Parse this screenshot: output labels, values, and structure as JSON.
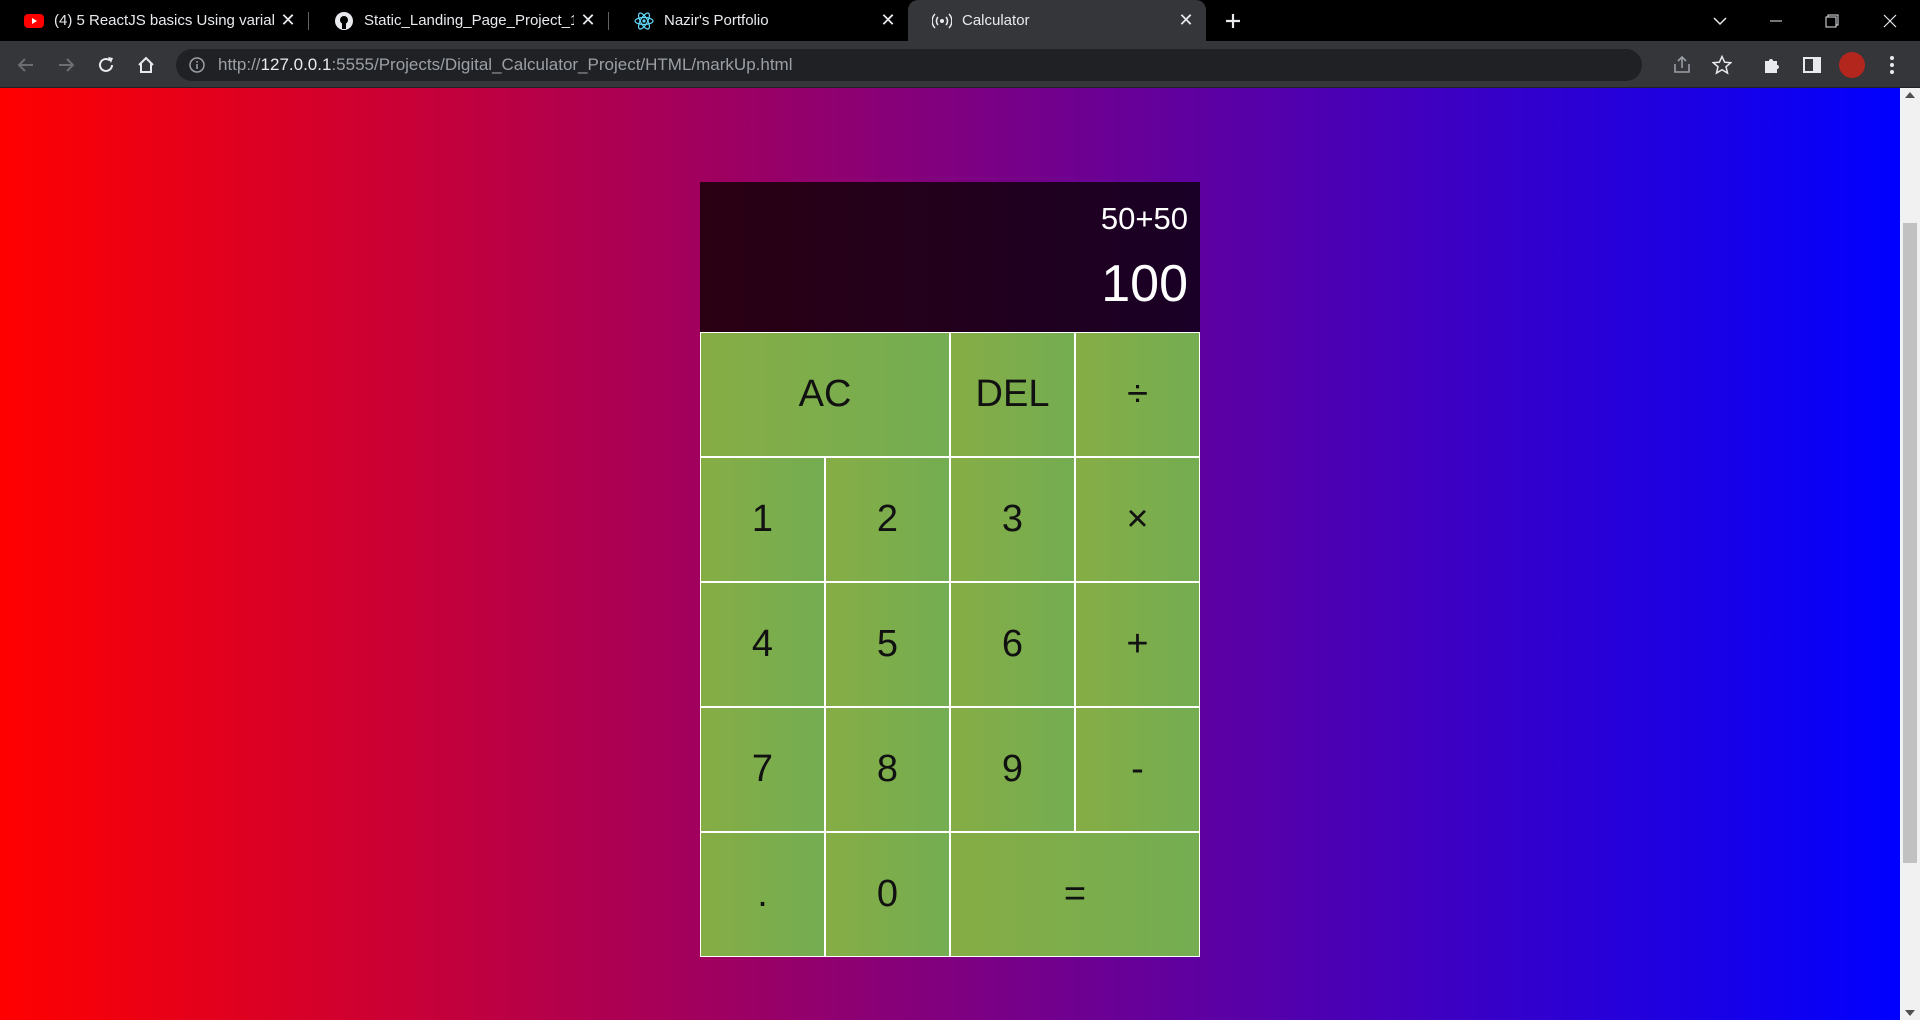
{
  "browser": {
    "tabs": [
      {
        "title": "(4) 5 ReactJS basics Using variabl",
        "favicon": "youtube-icon",
        "active": false
      },
      {
        "title": "Static_Landing_Page_Project_1/H",
        "favicon": "github-icon",
        "active": false
      },
      {
        "title": "Nazir's Portfolio",
        "favicon": "react-icon",
        "active": false
      },
      {
        "title": "Calculator",
        "favicon": "broadcast-icon",
        "active": true
      }
    ],
    "url": {
      "scheme": "http://",
      "host": "127.0.0.1",
      "rest": ":5555/Projects/Digital_Calculator_Project/HTML/markUp.html"
    }
  },
  "calculator": {
    "previous_operand": "50+50",
    "current_operand": "100",
    "keys": {
      "ac": "AC",
      "del": "DEL",
      "divide": "÷",
      "one": "1",
      "two": "2",
      "three": "3",
      "multiply": "×",
      "four": "4",
      "five": "5",
      "six": "6",
      "plus": "+",
      "seven": "7",
      "eight": "8",
      "nine": "9",
      "minus": "-",
      "dot": ".",
      "zero": "0",
      "equals": "="
    }
  },
  "colors": {
    "page_gradient_start": "#ff0000",
    "page_gradient_end": "#0000ff",
    "key_green": "#7dad4b",
    "display_dark": "#220018"
  }
}
